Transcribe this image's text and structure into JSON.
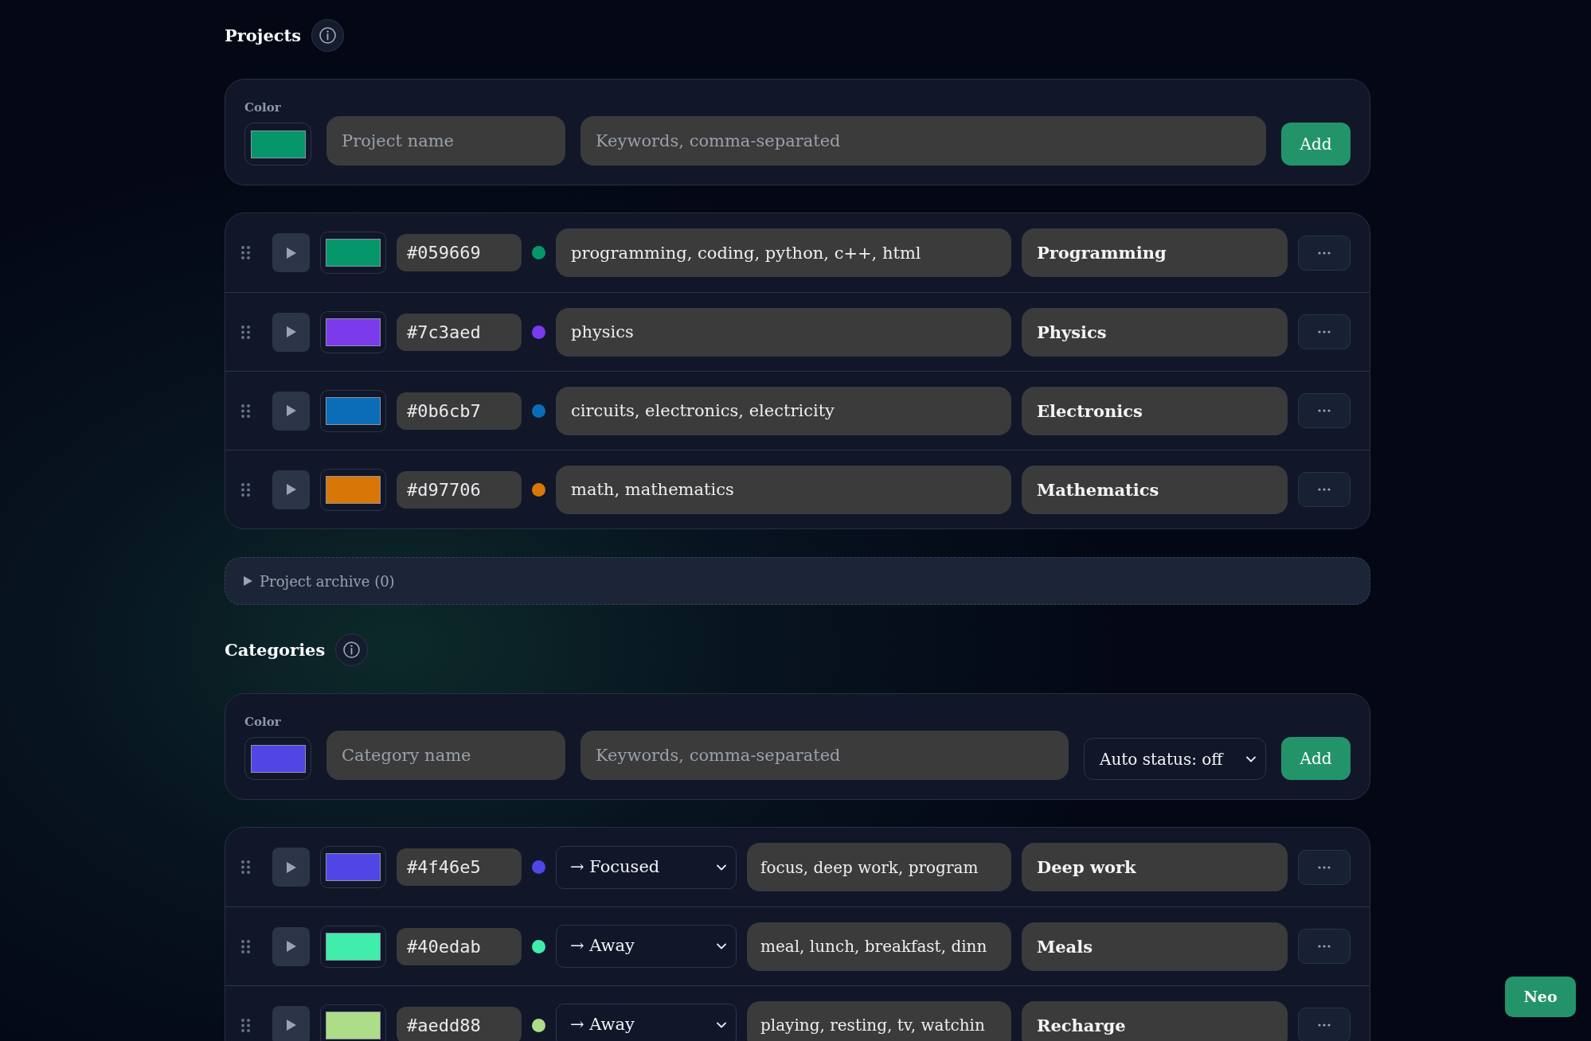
{
  "projects": {
    "title": "Projects",
    "form": {
      "color_label": "Color",
      "color": "#059669",
      "name_placeholder": "Project name",
      "keywords_placeholder": "Keywords, comma-separated",
      "add_label": "Add"
    },
    "items": [
      {
        "hex": "#059669",
        "color": "#059669",
        "keywords": "programming, coding, python, c++, html",
        "name": "Programming"
      },
      {
        "hex": "#7c3aed",
        "color": "#7c3aed",
        "keywords": "physics",
        "name": "Physics"
      },
      {
        "hex": "#0b6cb7",
        "color": "#0b6cb7",
        "keywords": "circuits, electronics, electricity",
        "name": "Electronics"
      },
      {
        "hex": "#d97706",
        "color": "#d97706",
        "keywords": "math, mathematics",
        "name": "Mathematics"
      }
    ],
    "archive": {
      "label": "Project archive (0)",
      "expanded": false
    }
  },
  "categories": {
    "title": "Categories",
    "form": {
      "color_label": "Color",
      "color": "#4f46e5",
      "name_placeholder": "Category name",
      "keywords_placeholder": "Keywords, comma-separated",
      "status": "Auto status: off",
      "add_label": "Add"
    },
    "items": [
      {
        "hex": "#4f46e5",
        "color": "#4f46e5",
        "status": "→ Focused",
        "keywords": "focus, deep work, program",
        "name": "Deep work"
      },
      {
        "hex": "#40edab",
        "color": "#40edab",
        "status": "→ Away",
        "keywords": "meal, lunch, breakfast, dinn",
        "name": "Meals"
      },
      {
        "hex": "#aedd88",
        "color": "#aedd88",
        "status": "→ Away",
        "keywords": "playing, resting, tv, watchin",
        "name": "Recharge"
      }
    ]
  },
  "assistant_button": {
    "label": "Neo"
  }
}
